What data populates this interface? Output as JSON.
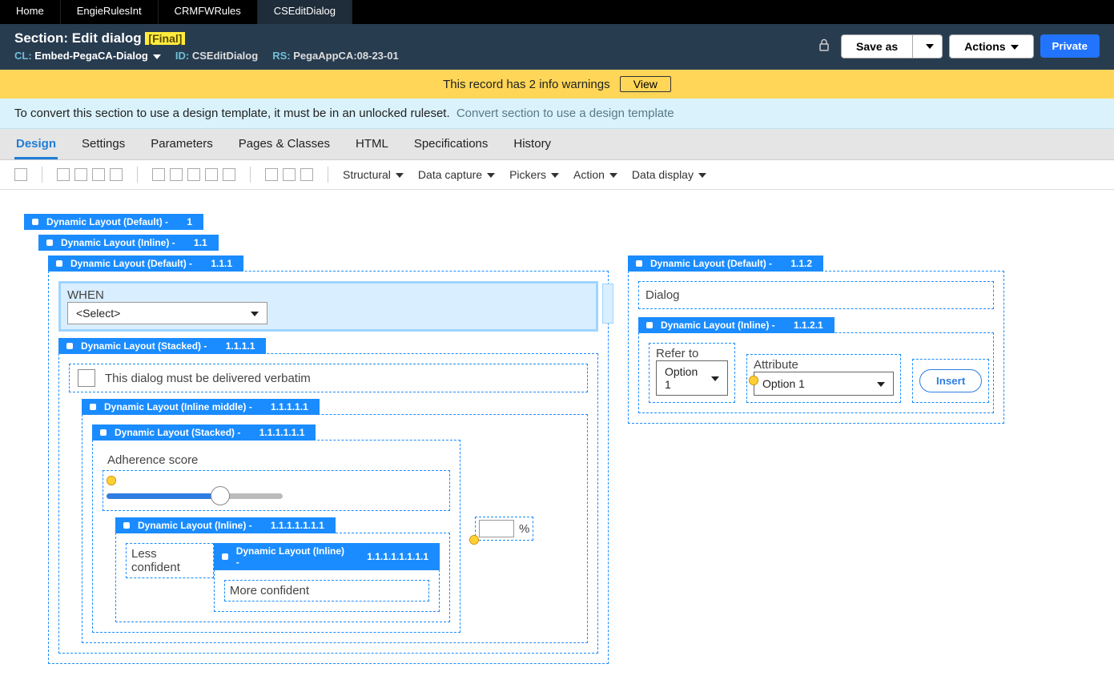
{
  "topTabs": {
    "items": [
      "Home",
      "EngieRulesInt",
      "CRMFWRules",
      "CSEditDialog"
    ],
    "activeIndex": 3
  },
  "header": {
    "kind": "Section:",
    "title": "Edit dialog",
    "badge": "[Final]",
    "cl_label": "CL:",
    "cl_value": "Embed-PegaCA-Dialog",
    "id_label": "ID:",
    "id_value": "CSEditDialog",
    "rs_label": "RS:",
    "rs_value": "PegaAppCA:08-23-01",
    "saveAs": "Save as",
    "actions": "Actions",
    "private": "Private"
  },
  "warningBanner": {
    "text": "This record has 2 info warnings",
    "viewLabel": "View"
  },
  "infoBanner": {
    "text": "To convert this section to use a design template, it must be in an unlocked ruleset.",
    "link": "Convert section to use a design template"
  },
  "subtabs": {
    "items": [
      "Design",
      "Settings",
      "Parameters",
      "Pages & Classes",
      "HTML",
      "Specifications",
      "History"
    ],
    "activeIndex": 0
  },
  "toolbarMenus": [
    "Structural",
    "Data capture",
    "Pickers",
    "Action",
    "Data display"
  ],
  "layouts": {
    "l1": {
      "label": "Dynamic Layout (Default) -",
      "id": "1"
    },
    "l11": {
      "label": "Dynamic Layout (Inline) -",
      "id": "1.1"
    },
    "l111": {
      "label": "Dynamic Layout (Default) -",
      "id": "1.1.1"
    },
    "l1111": {
      "label": "Dynamic Layout (Stacked) -",
      "id": "1.1.1.1"
    },
    "l11111": {
      "label": "Dynamic Layout (Inline middle) -",
      "id": "1.1.1.1.1"
    },
    "l111111": {
      "label": "Dynamic Layout (Stacked) -",
      "id": "1.1.1.1.1.1"
    },
    "l1111111": {
      "label": "Dynamic Layout (Inline) -",
      "id": "1.1.1.1.1.1.1"
    },
    "l11111111": {
      "label": "Dynamic Layout (Inline) -",
      "id": "1.1.1.1.1.1.1.1"
    },
    "l112": {
      "label": "Dynamic Layout (Default) -",
      "id": "1.1.2"
    },
    "l1121": {
      "label": "Dynamic Layout (Inline) -",
      "id": "1.1.2.1"
    }
  },
  "fields": {
    "when_label": "WHEN",
    "when_placeholder": "<Select>",
    "verbatim_label": "This dialog must be delivered verbatim",
    "adherence_label": "Adherence score",
    "less_confident": "Less confident",
    "more_confident": "More confident",
    "percent_unit": "%",
    "dialog_label": "Dialog",
    "referTo_label": "Refer to",
    "referTo_value": "Option 1",
    "attribute_label": "Attribute",
    "attribute_value": "Option 1",
    "insert_label": "Insert"
  }
}
